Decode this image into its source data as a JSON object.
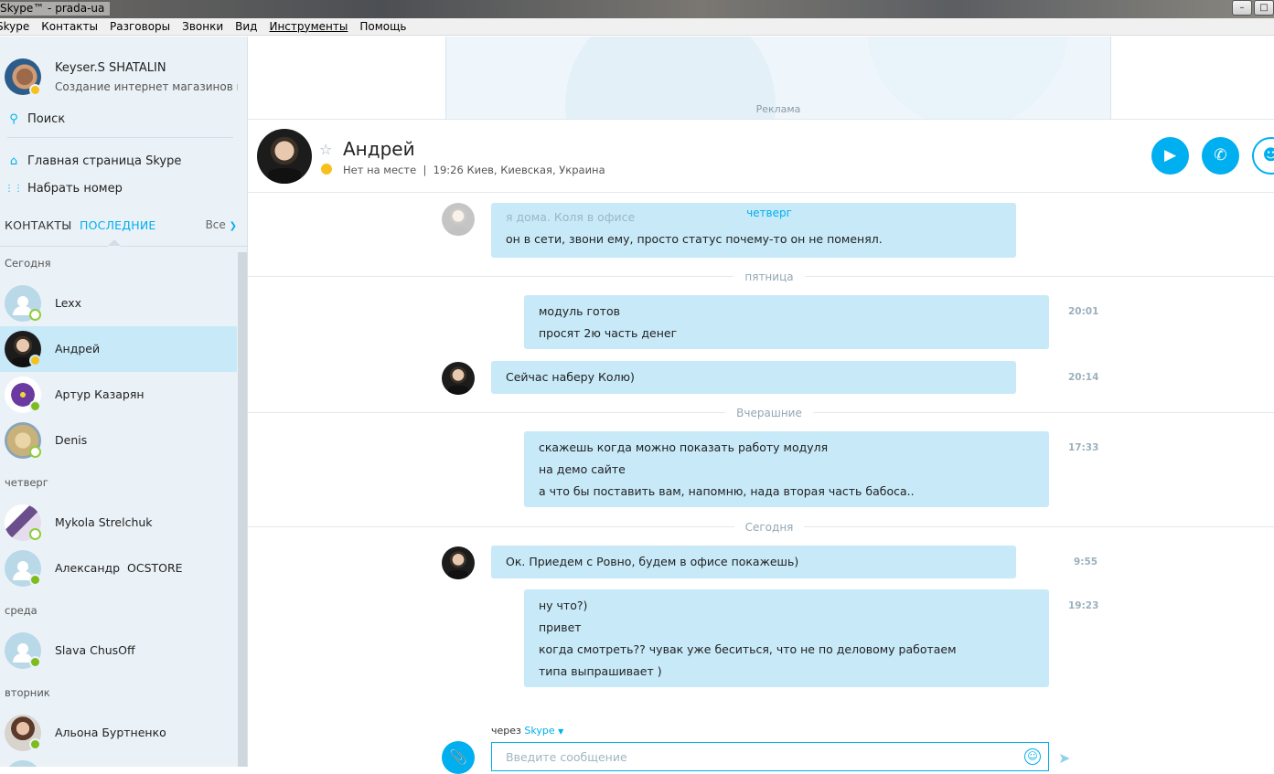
{
  "window": {
    "title": "Skype™ - prada-ua"
  },
  "menu": [
    "Skype",
    "Контакты",
    "Разговоры",
    "Звонки",
    "Вид",
    "Инструменты",
    "Помощь"
  ],
  "profile": {
    "name": "Keyser.S SHATALIN",
    "mood": "Создание интернет магазинов по..."
  },
  "sidebar": {
    "search_label": "Поиск",
    "home_label": "Главная страница Skype",
    "dial_label": "Набрать номер",
    "tab_contacts": "КОНТАКТЫ",
    "tab_recent": "ПОСЛЕДНИЕ",
    "filter_label": "Все",
    "groups": [
      {
        "label": "Сегодня",
        "contacts": [
          {
            "name": "Lexx",
            "status": "offline"
          },
          {
            "name": "Андрей",
            "status": "away",
            "selected": true
          },
          {
            "name": "Артур Казарян",
            "status": "online"
          },
          {
            "name": "Denis",
            "status": "offline"
          }
        ]
      },
      {
        "label": "четверг",
        "contacts": [
          {
            "name": "Mykola Strelchuk",
            "status": "offline"
          },
          {
            "name": "Александр  OCSTORE",
            "status": "online"
          }
        ]
      },
      {
        "label": "среда",
        "contacts": [
          {
            "name": "Slava ChusOff",
            "status": "online"
          }
        ]
      },
      {
        "label": "вторник",
        "contacts": [
          {
            "name": "Альона Буртненко",
            "status": "online"
          }
        ]
      }
    ]
  },
  "ad": {
    "label": "Реклама"
  },
  "chat": {
    "name": "Андрей",
    "status": "Нет на месте  |  19:26 Киев, Киевская, Украина"
  },
  "messages": {
    "day_thursday": "четверг",
    "faded_text": "я дома. Коля в офисе",
    "thursday_msg": "он в сети, звони ему, просто статус почему-то он не поменял.",
    "day_friday": "пятница",
    "fri_out_lines": [
      "модуль готов",
      "просят 2ю часть денег"
    ],
    "fri_out_time": "20:01",
    "fri_in_text": "Сейчас наберу Колю)",
    "fri_in_time": "20:14",
    "day_yesterday": "Вчерашние",
    "yest_out_lines": [
      "скажешь когда можно показать работу модуля",
      "на демо сайте",
      "а что бы поставить вам, напомню, нада вторая часть бабоса.."
    ],
    "yest_out_time": "17:33",
    "day_today": "Сегодня",
    "today_in_text": "Ок. Приедем с Ровно, будем в офисе покажешь)",
    "today_in_time": "9:55",
    "today_out_lines": [
      "ну что?)",
      "привет",
      "когда смотреть?? чувак уже беситься, что не по деловому работаем",
      "типа выпрашивает )"
    ],
    "today_out_time": "19:23"
  },
  "compose": {
    "via_prefix": "через",
    "via_service": "Skype",
    "placeholder": "Введите сообщение"
  },
  "colors": {
    "accent": "#00aff0",
    "bubble": "#c7e9f8",
    "away": "#f6c11b",
    "online": "#7dbb1e"
  }
}
